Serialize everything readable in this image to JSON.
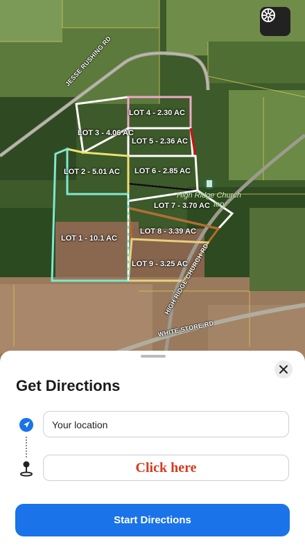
{
  "map": {
    "lots": [
      {
        "label": "LOT 1 - 10.1 AC"
      },
      {
        "label": "LOT 2 - 5.01 AC"
      },
      {
        "label": "LOT 3 - 4.06 AC"
      },
      {
        "label": "LOT 4 - 2.30 AC"
      },
      {
        "label": "LOT 5 - 2.36 AC"
      },
      {
        "label": "LOT 6 - 2.85 AC"
      },
      {
        "label": "LOT 7 - 3.70 AC"
      },
      {
        "label": "LOT 8 - 3.39 AC"
      },
      {
        "label": "LOT 9 - 3.25 AC"
      }
    ],
    "roads": {
      "jesse_rushing": "JESSE RUSHING RD",
      "high_ridge_church": "HIGH RIDGE CHURCH RD",
      "white_store": "WHITE STORE RD"
    },
    "poi": {
      "line1": "High Ridge Church",
      "line2": "tery"
    },
    "compass_icon": "compass-icon"
  },
  "sheet": {
    "title": "Get Directions",
    "origin_value": "Your location",
    "destination_value": "Click here",
    "start_button": "Start Directions",
    "close_icon": "close-icon",
    "accent_color": "#1a73e8",
    "highlight_color": "#d43b1c"
  }
}
